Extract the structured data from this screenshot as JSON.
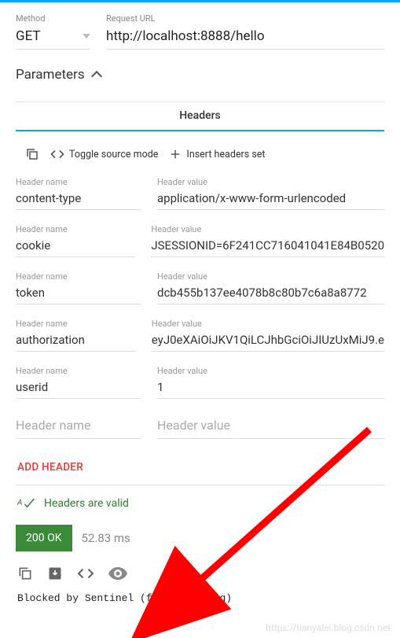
{
  "topbar": {
    "color": "#03a9f4"
  },
  "method": {
    "label": "Method",
    "value": "GET"
  },
  "url": {
    "label": "Request URL",
    "value": "http://localhost:8888/hello"
  },
  "parameters": {
    "title": "Parameters",
    "expanded": true
  },
  "tabs": {
    "active": "Headers"
  },
  "toolbar": {
    "copy_icon": "copy",
    "code_icon": "code",
    "toggle_label": "Toggle source mode",
    "plus_icon": "plus",
    "insert_label": "Insert headers set"
  },
  "header_name_label": "Header name",
  "header_value_label": "Header value",
  "headers": [
    {
      "name": "content-type",
      "value": "application/x-www-form-urlencoded"
    },
    {
      "name": "cookie",
      "value": "JSESSIONID=6F241CC716041041E84B0520"
    },
    {
      "name": "token",
      "value": "dcb455b137ee4078b8c80b7c6a8a8772"
    },
    {
      "name": "authorization",
      "value": "eyJ0eXAiOiJKV1QiLCJhbGciOiJIUzUxMiJ9.e"
    },
    {
      "name": "userid",
      "value": "1"
    }
  ],
  "empty_header": {
    "name_placeholder": "Header name",
    "value_placeholder": "Header value"
  },
  "add_header_label": "ADD HEADER",
  "validation": {
    "icon": "text-check",
    "text": "Headers are valid",
    "color": "#2e7d32"
  },
  "response": {
    "status_text": "200 OK",
    "status_color": "#3a8a3a",
    "time": "52.83 ms",
    "body": "Blocked by Sentinel (flow limiting)"
  },
  "response_icons": {
    "copy": "copy",
    "download": "download",
    "code": "code",
    "preview": "eye"
  },
  "watermark": "https://tianyalei.blog.csdn.net",
  "annotation_arrow": {
    "color": "#ff0000"
  }
}
